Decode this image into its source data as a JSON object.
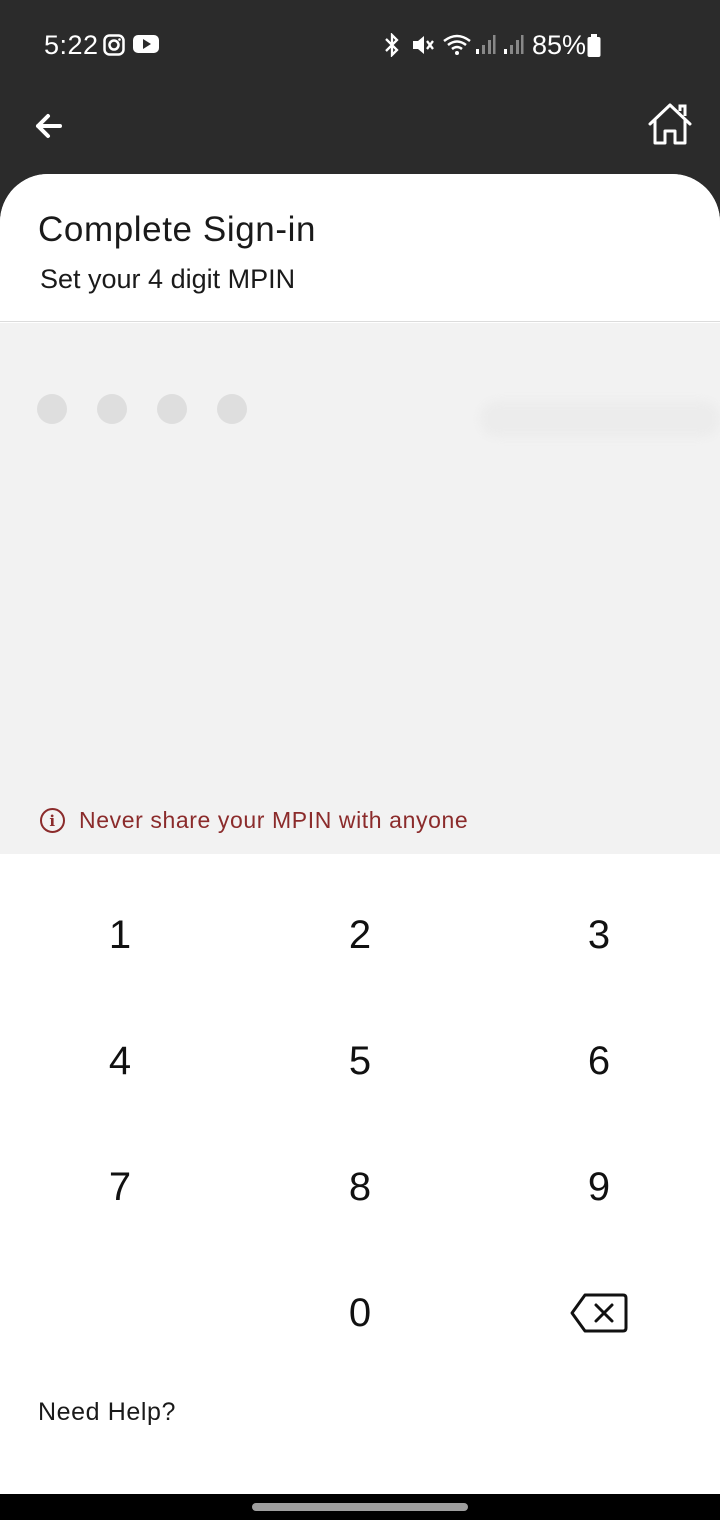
{
  "status_bar": {
    "time": "5:22",
    "battery": "85%",
    "icons": [
      "instagram-icon",
      "youtube-icon",
      "bluetooth-icon",
      "mute-icon",
      "wifi-icon",
      "signal-icon",
      "signal-icon",
      "battery-icon"
    ]
  },
  "app_bar": {
    "back_icon": "arrow-left-icon",
    "home_icon": "home-icon"
  },
  "header": {
    "title": "Complete Sign-in",
    "subtitle": "Set your 4 digit MPIN"
  },
  "pin": {
    "length": 4,
    "filled": 0
  },
  "warning": {
    "icon": "info-icon",
    "text": "Never share your MPIN with anyone"
  },
  "keypad": {
    "keys": [
      "1",
      "2",
      "3",
      "4",
      "5",
      "6",
      "7",
      "8",
      "9",
      "0"
    ],
    "backspace_icon": "backspace-icon"
  },
  "help": {
    "label": "Need Help?"
  },
  "colors": {
    "background_dark": "#2b2b2b",
    "sheet": "#ffffff",
    "pin_area": "#f2f2f2",
    "warning": "#8b2b2b"
  }
}
